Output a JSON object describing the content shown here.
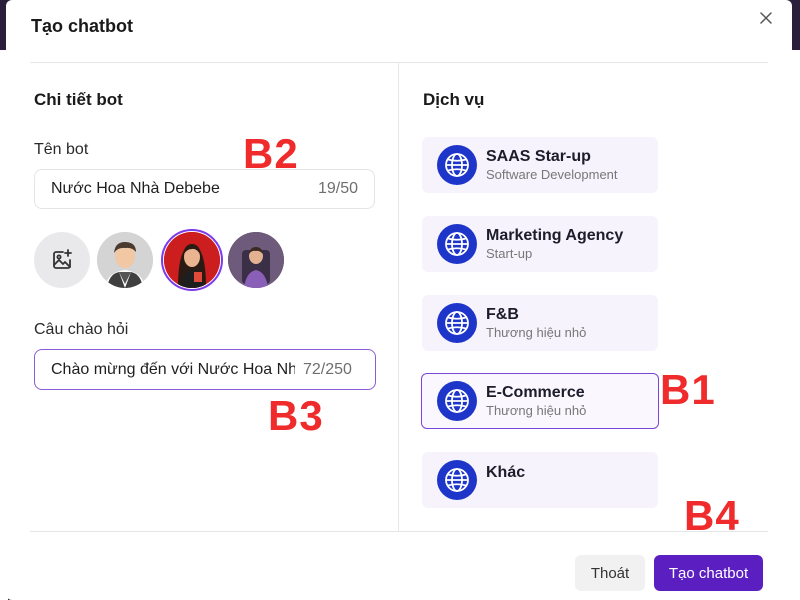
{
  "modal": {
    "title": "Tạo chatbot"
  },
  "bot_details": {
    "section_title": "Chi tiết bot",
    "name_label": "Tên bot",
    "name_value": "Nước Hoa Nhà Debebe",
    "name_counter": "19/50",
    "greeting_label": "Câu chào hỏi",
    "greeting_value": "Chào mừng đến với Nước Hoa Nhà Debebe",
    "greeting_counter": "72/250"
  },
  "services": {
    "section_title": "Dịch vụ",
    "items": [
      {
        "name": "SAAS Star-up",
        "sub": "Software Development"
      },
      {
        "name": "Marketing Agency",
        "sub": "Start-up"
      },
      {
        "name": "F&B",
        "sub": "Thương hiệu nhỏ"
      },
      {
        "name": "E-Commerce",
        "sub": "Thương hiệu nhỏ",
        "selected": true
      },
      {
        "name": "Khác",
        "sub": ""
      }
    ]
  },
  "annotations": {
    "b1": "B1",
    "b2": "B2",
    "b3": "B3",
    "b4": "B4"
  },
  "footer": {
    "exit_label": "Thoát",
    "create_label": "Tạo chatbot"
  },
  "colors": {
    "accent": "#5b1fc1",
    "globe": "#1d36c9",
    "annotation": "#ef2b2b"
  }
}
